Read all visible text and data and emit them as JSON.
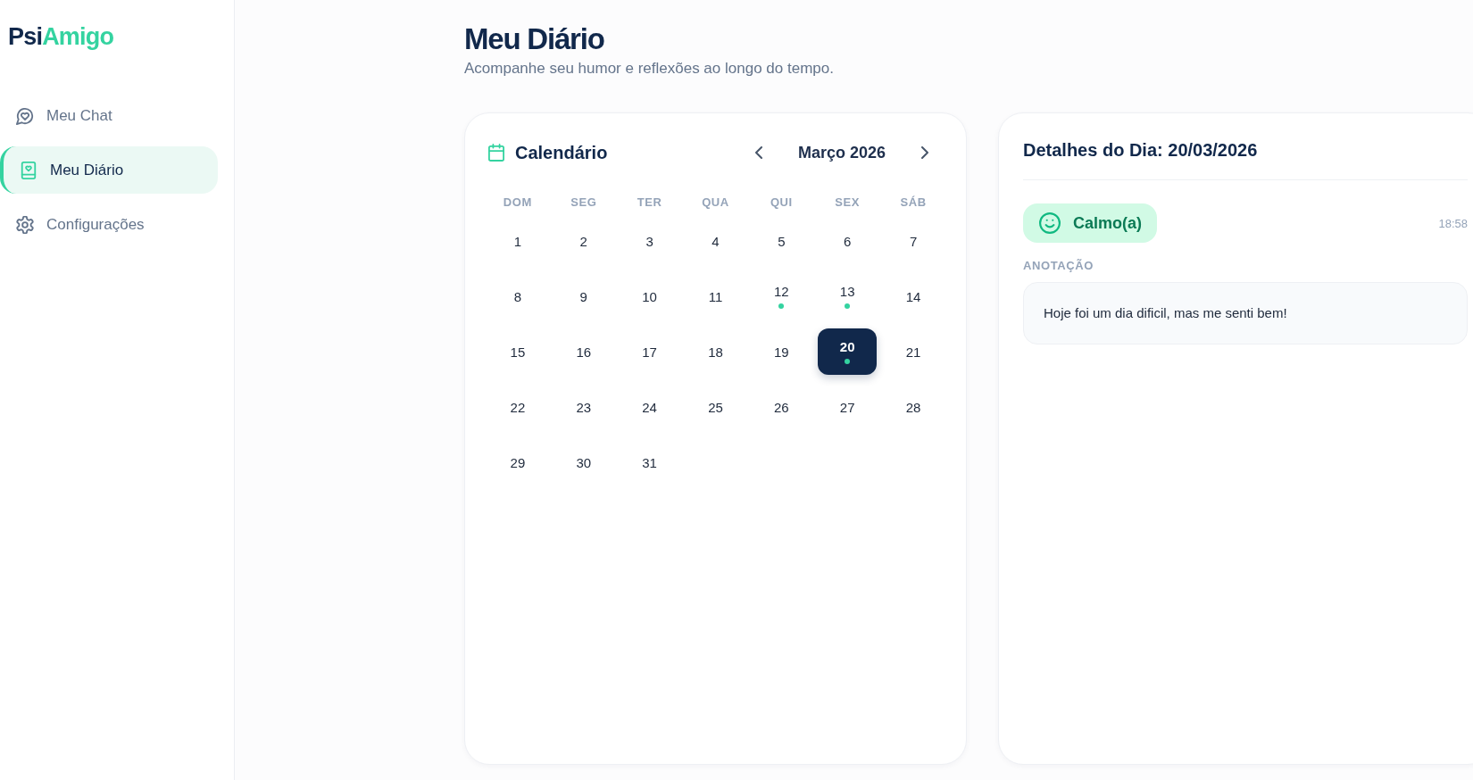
{
  "sidebar": {
    "logo": [
      "Psi",
      "Amigo"
    ],
    "items": [
      {
        "label": "Meu Chat",
        "kind": "chat",
        "selected": false
      },
      {
        "label": "Meu Diário",
        "kind": "diary",
        "selected": true
      },
      {
        "label": "Configurações",
        "kind": "settings",
        "selected": false
      }
    ]
  },
  "header": {
    "title": "Meu Diário",
    "subtitle": "Acompanhe seu humor e reflexões ao longo do tempo."
  },
  "calendar": {
    "title": "Calendário",
    "month": "Março 2026",
    "weekdays": [
      "DOM",
      "SEG",
      "TER",
      "QUA",
      "QUI",
      "SEX",
      "SÁB"
    ],
    "days": [
      {
        "label": "1",
        "has_entry": false,
        "selected": false
      },
      {
        "label": "2",
        "has_entry": false,
        "selected": false
      },
      {
        "label": "3",
        "has_entry": false,
        "selected": false
      },
      {
        "label": "4",
        "has_entry": false,
        "selected": false
      },
      {
        "label": "5",
        "has_entry": false,
        "selected": false
      },
      {
        "label": "6",
        "has_entry": false,
        "selected": false
      },
      {
        "label": "7",
        "has_entry": false,
        "selected": false
      },
      {
        "label": "8",
        "has_entry": false,
        "selected": false
      },
      {
        "label": "9",
        "has_entry": false,
        "selected": false
      },
      {
        "label": "10",
        "has_entry": false,
        "selected": false
      },
      {
        "label": "11",
        "has_entry": false,
        "selected": false
      },
      {
        "label": "12",
        "has_entry": true,
        "selected": false
      },
      {
        "label": "13",
        "has_entry": true,
        "selected": false
      },
      {
        "label": "14",
        "has_entry": false,
        "selected": false
      },
      {
        "label": "15",
        "has_entry": false,
        "selected": false
      },
      {
        "label": "16",
        "has_entry": false,
        "selected": false
      },
      {
        "label": "17",
        "has_entry": false,
        "selected": false
      },
      {
        "label": "18",
        "has_entry": false,
        "selected": false
      },
      {
        "label": "19",
        "has_entry": false,
        "selected": false
      },
      {
        "label": "20",
        "has_entry": true,
        "selected": true
      },
      {
        "label": "21",
        "has_entry": false,
        "selected": false
      },
      {
        "label": "22",
        "has_entry": false,
        "selected": false
      },
      {
        "label": "23",
        "has_entry": false,
        "selected": false
      },
      {
        "label": "24",
        "has_entry": false,
        "selected": false
      },
      {
        "label": "25",
        "has_entry": false,
        "selected": false
      },
      {
        "label": "26",
        "has_entry": false,
        "selected": false
      },
      {
        "label": "27",
        "has_entry": false,
        "selected": false
      },
      {
        "label": "28",
        "has_entry": false,
        "selected": false
      },
      {
        "label": "29",
        "has_entry": false,
        "selected": false
      },
      {
        "label": "30",
        "has_entry": false,
        "selected": false
      },
      {
        "label": "31",
        "has_entry": false,
        "selected": false
      }
    ]
  },
  "details": {
    "title": "Detalhes do Dia: 20/03/2026",
    "mood": "Calmo(a)",
    "time": "18:58",
    "note_label": "ANOTAÇÃO",
    "note": "Hoje foi um dia dificil, mas me senti bem!"
  }
}
